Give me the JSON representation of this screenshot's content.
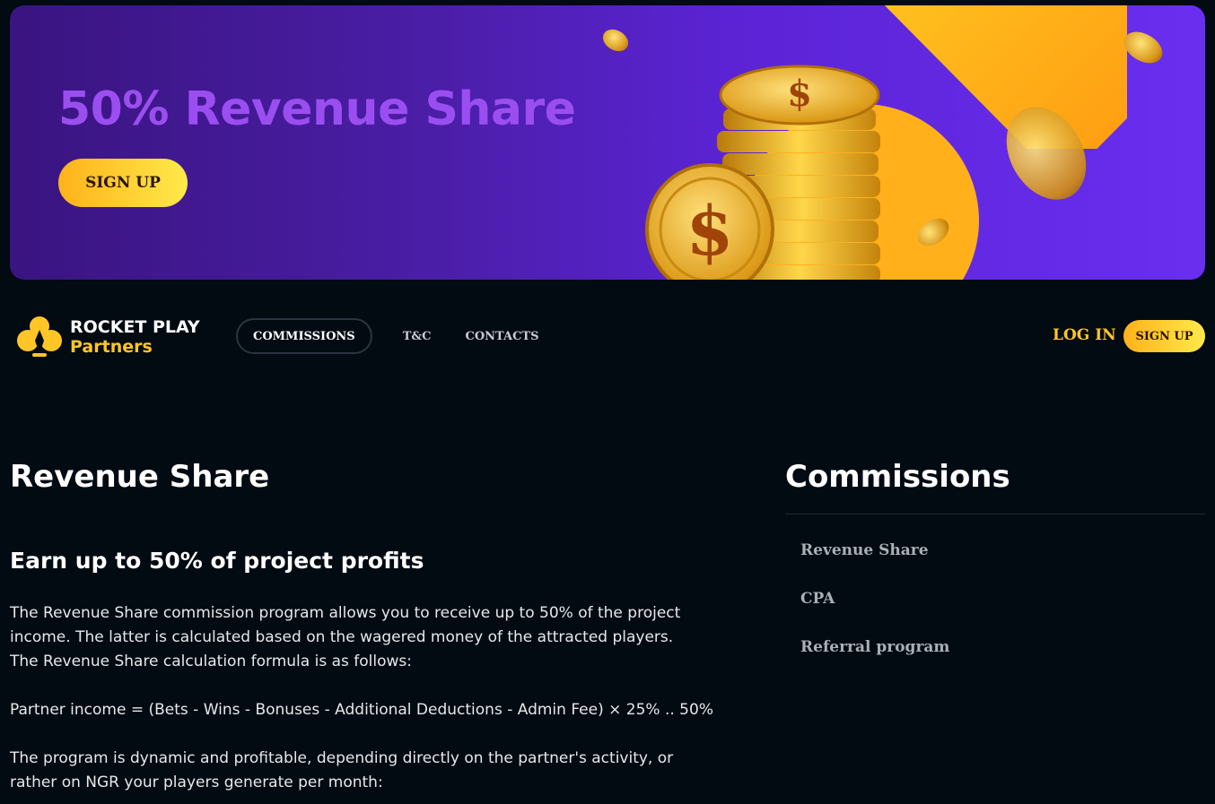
{
  "banner": {
    "title": "50% Revenue Share",
    "signup_label": "SIGN UP"
  },
  "header": {
    "logo_line1": "ROCKET PLAY",
    "logo_line2": "Partners",
    "nav": [
      {
        "label": "COMMISSIONS",
        "active": true
      },
      {
        "label": "T&C"
      },
      {
        "label": "CONTACTS"
      }
    ],
    "login_label": "LOG IN",
    "signup_label": "SIGN UP"
  },
  "main": {
    "title": "Revenue Share",
    "subtitle": "Earn up to 50% of project profits",
    "p1": "The Revenue Share commission program allows you to receive up to 50% of the project income. The latter is calculated based on the wagered money of the attracted players.",
    "p2": "The Revenue Share calculation formula is as follows:",
    "p3": "Partner income = (Bets - Wins - Bonuses - Additional Deductions - Admin Fee) × 25% .. 50%",
    "p4": "The program is dynamic and profitable, depending directly on the partner's activity, or rather on NGR your players generate per month:"
  },
  "sidebar": {
    "title": "Commissions",
    "items": [
      {
        "label": "Revenue Share"
      },
      {
        "label": "CPA"
      },
      {
        "label": "Referral program"
      }
    ]
  },
  "colors": {
    "accent": "#ffc626",
    "banner_title": "#9b4ef0",
    "background": "#020a12"
  }
}
